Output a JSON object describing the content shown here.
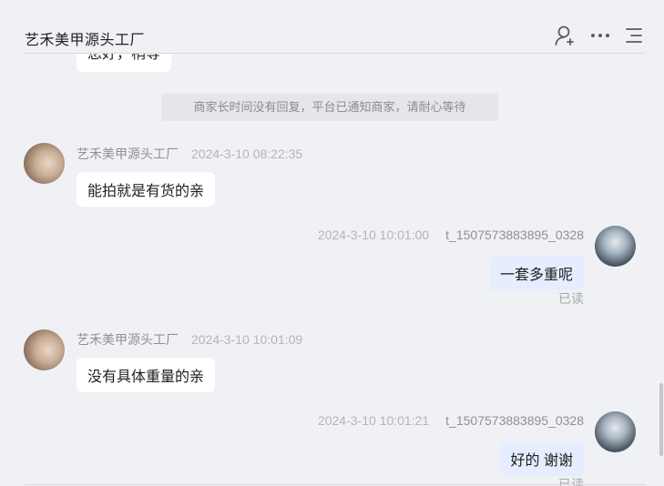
{
  "header": {
    "title": "艺禾美甲源头工厂",
    "icons": [
      "user-add-icon",
      "more-icon",
      "list-menu-icon"
    ]
  },
  "notice": "商家长时间没有回复，平台已通知商家，请耐心等待",
  "messages": [
    {
      "side": "left",
      "text": "您好，稍等",
      "partial": true
    },
    {
      "side": "left",
      "name": "艺禾美甲源头工厂",
      "time": "2024-3-10 08:22:35",
      "text": "能拍就是有货的亲"
    },
    {
      "side": "right",
      "name": "t_1507573883895_0328",
      "time": "2024-3-10 10:01:00",
      "text": "一套多重呢",
      "status": "已读"
    },
    {
      "side": "left",
      "name": "艺禾美甲源头工厂",
      "time": "2024-3-10 10:01:09",
      "text": "没有具体重量的亲"
    },
    {
      "side": "right",
      "name": "t_1507573883895_0328",
      "time": "2024-3-10 10:01:21",
      "text": "好的 谢谢",
      "status": "已读"
    }
  ],
  "colors": {
    "background": "#f0f1f5",
    "bubble_other": "#ffffff",
    "bubble_mine": "#e5edff",
    "notice_bg": "#e5e6ea"
  }
}
